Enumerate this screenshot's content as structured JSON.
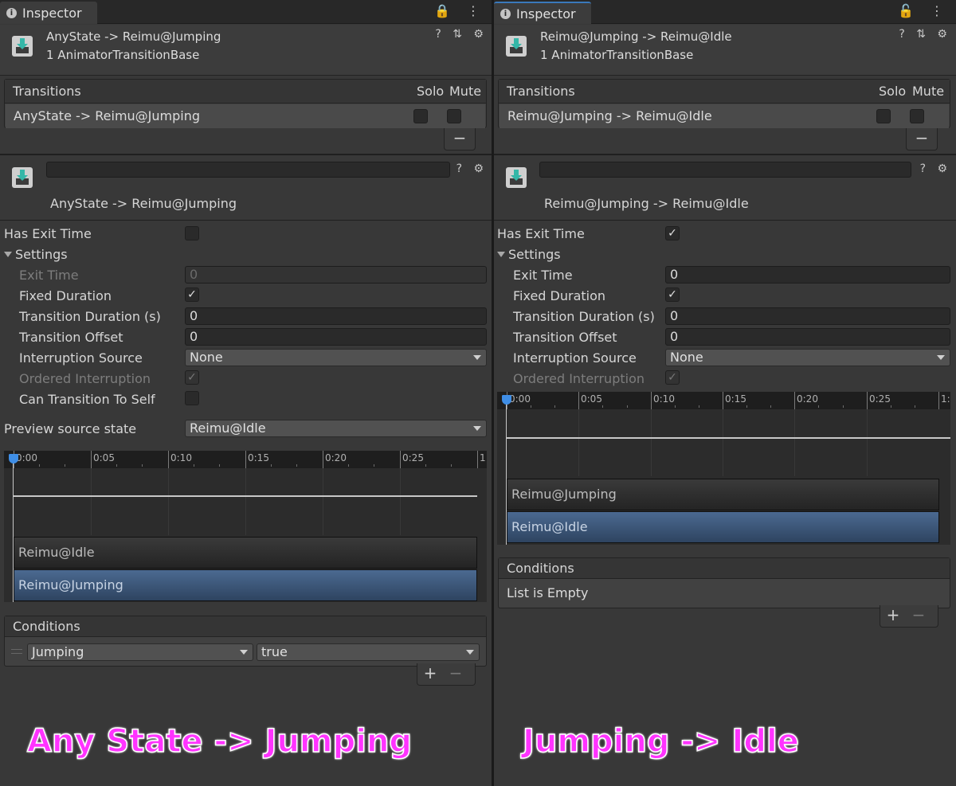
{
  "colors": {
    "accent": "#3a79bb",
    "caption": "#ff33ff",
    "blue_bar": "#3d5a80",
    "panel": "#383838"
  },
  "left": {
    "tab_label": "Inspector",
    "tab_icons": "🔒 ⋮",
    "header_title": "AnyState -> Reimu@Jumping",
    "header_subtitle": "1 AnimatorTransitionBase",
    "header_icons": "? ⇅ ⚙",
    "transitions": {
      "title": "Transitions",
      "solo": "Solo",
      "mute": "Mute",
      "row": "AnyState -> Reimu@Jumping",
      "solo_checked": false,
      "mute_checked": false,
      "remove": "−"
    },
    "name_field_value": "",
    "name_icons": "? ⚙",
    "transition_name": "AnyState -> Reimu@Jumping",
    "has_exit_time_label": "Has Exit Time",
    "has_exit_time": false,
    "settings_label": "Settings",
    "exit_time_label": "Exit Time",
    "exit_time_value": "0",
    "fixed_duration_label": "Fixed Duration",
    "fixed_duration": true,
    "transition_duration_label": "Transition Duration (s)",
    "transition_duration_value": "0",
    "transition_offset_label": "Transition Offset",
    "transition_offset_value": "0",
    "interruption_source_label": "Interruption Source",
    "interruption_source_value": "None",
    "ordered_interruption_label": "Ordered Interruption",
    "ordered_interruption": true,
    "can_transition_to_self_label": "Can Transition To Self",
    "can_transition_to_self": false,
    "preview_source_label": "Preview source state",
    "preview_source_value": "Reimu@Idle",
    "timeline_ticks": [
      "0:00",
      "0:05",
      "0:10",
      "0:15",
      "0:20",
      "0:25",
      "1:"
    ],
    "bar_top": "Reimu@Idle",
    "bar_bottom": "Reimu@Jumping",
    "conditions_title": "Conditions",
    "condition_param": "Jumping",
    "condition_value": "true",
    "add": "+",
    "remove": "−"
  },
  "right": {
    "tab_label": "Inspector",
    "tab_icons": "🔓 ⋮",
    "header_title": "Reimu@Jumping -> Reimu@Idle",
    "header_subtitle": "1 AnimatorTransitionBase",
    "header_icons": "? ⇅ ⚙",
    "transitions": {
      "title": "Transitions",
      "solo": "Solo",
      "mute": "Mute",
      "row": "Reimu@Jumping -> Reimu@Idle",
      "solo_checked": false,
      "mute_checked": false,
      "remove": "−"
    },
    "name_field_value": "",
    "name_icons": "? ⚙",
    "transition_name": "Reimu@Jumping -> Reimu@Idle",
    "has_exit_time_label": "Has Exit Time",
    "has_exit_time": true,
    "settings_label": "Settings",
    "exit_time_label": "Exit Time",
    "exit_time_value": "0",
    "fixed_duration_label": "Fixed Duration",
    "fixed_duration": true,
    "transition_duration_label": "Transition Duration (s)",
    "transition_duration_value": "0",
    "transition_offset_label": "Transition Offset",
    "transition_offset_value": "0",
    "interruption_source_label": "Interruption Source",
    "interruption_source_value": "None",
    "ordered_interruption_label": "Ordered Interruption",
    "ordered_interruption": true,
    "timeline_ticks": [
      "0:00",
      "0:05",
      "0:10",
      "0:15",
      "0:20",
      "0:25",
      "1:"
    ],
    "bar_top": "Reimu@Jumping",
    "bar_bottom": "Reimu@Idle",
    "conditions_title": "Conditions",
    "conditions_empty": "List is Empty",
    "add": "+",
    "remove": "−"
  },
  "captions": {
    "left": "Any State -> Jumping",
    "right": "Jumping -> Idle"
  }
}
